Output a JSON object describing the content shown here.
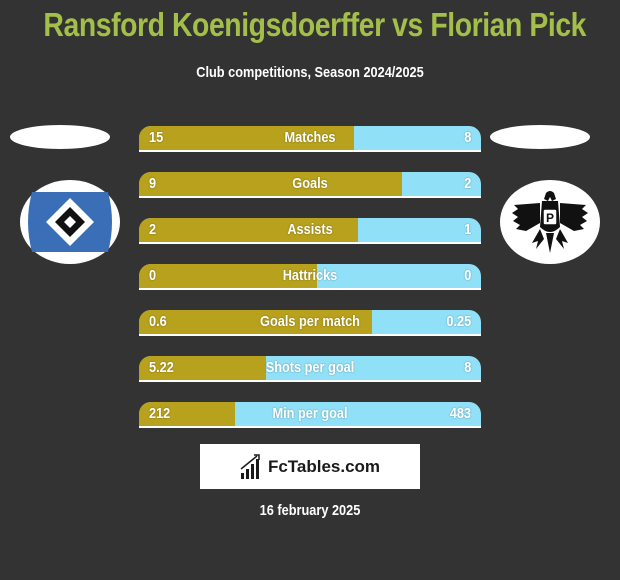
{
  "header": {
    "title": "Ransford Koenigsdoerffer vs Florian Pick",
    "subtitle": "Club competitions, Season 2024/2025"
  },
  "players": {
    "left": {
      "name": "Ransford Koenigsdoerffer",
      "club_logo": "hamburger-sv-diamond-logo"
    },
    "right": {
      "name": "Florian Pick",
      "club_logo": "preussen-muenster-eagle-logo"
    }
  },
  "colors": {
    "left_bar": "#b8a11c",
    "right_bar": "#90e0f7",
    "title": "#a3bf4a",
    "background": "#333333"
  },
  "stats": [
    {
      "label": "Matches",
      "left": "15",
      "right": "8",
      "left_share": 0.63
    },
    {
      "label": "Goals",
      "left": "9",
      "right": "2",
      "left_share": 0.77
    },
    {
      "label": "Assists",
      "left": "2",
      "right": "1",
      "left_share": 0.64
    },
    {
      "label": "Hattricks",
      "left": "0",
      "right": "0",
      "left_share": 0.52
    },
    {
      "label": "Goals per match",
      "left": "0.6",
      "right": "0.25",
      "left_share": 0.68
    },
    {
      "label": "Shots per goal",
      "left": "5.22",
      "right": "8",
      "left_share": 0.37
    },
    {
      "label": "Min per goal",
      "left": "212",
      "right": "483",
      "left_share": 0.28
    }
  ],
  "brand": {
    "name": "FcTables.com",
    "icon": "bar-chart-icon"
  },
  "date": "16 february 2025"
}
